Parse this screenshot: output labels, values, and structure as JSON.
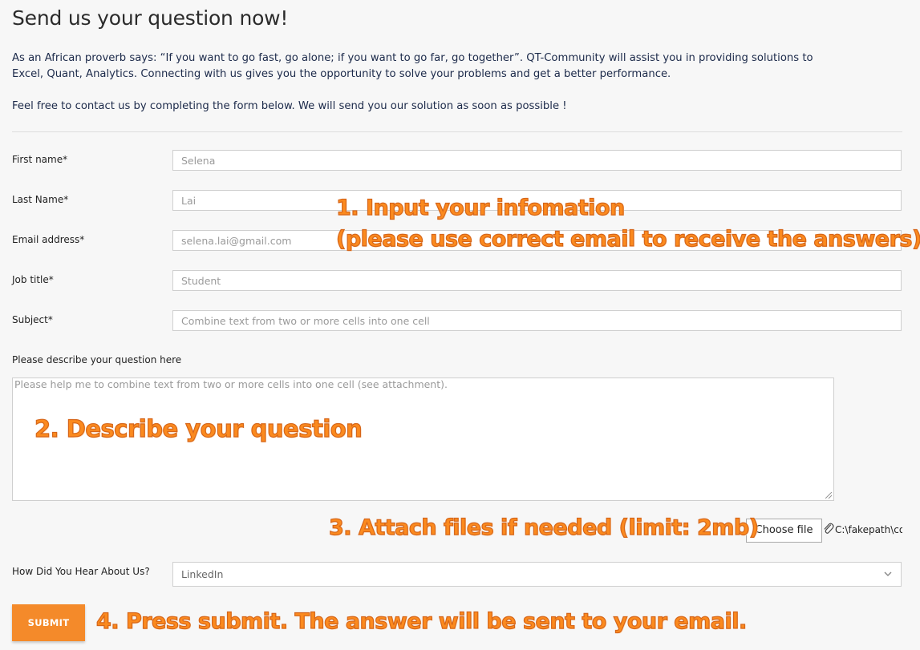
{
  "header": {
    "title": "Send us your question now!",
    "intro": "As an African proverb says: “If you want to go fast, go alone; if you want to go far, go together”. QT-Community will assist you in providing solutions to Excel, Quant, Analytics. Connecting with us gives you the opportunity to solve your problems and get a better performance.",
    "contact": "Feel free to contact us by completing the form below. We will send you our solution as soon as possible !"
  },
  "form": {
    "first_name": {
      "label": "First name*",
      "value": "Selena"
    },
    "last_name": {
      "label": "Last Name*",
      "value": "Lai"
    },
    "email": {
      "label": "Email address*",
      "value": "selena.lai@gmail.com"
    },
    "job_title": {
      "label": "Job title*",
      "value": "Student"
    },
    "subject": {
      "label": "Subject*",
      "value": "Combine text from two or more cells into one cell"
    },
    "description": {
      "label": "Please describe your question here",
      "value": "Please help me to combine text from two or more cells into one cell (see attachment)."
    },
    "file": {
      "button": "Choose file",
      "path": "C:\\fakepath\\combine-text.xlsx"
    },
    "hear_about": {
      "label": "How Did You Hear About Us?",
      "selected": "LinkedIn"
    },
    "submit_label": "SUBMIT"
  },
  "annotations": {
    "step1_line1": "1. Input your infomation",
    "step1_line2": "(please use correct email to receive the answers)",
    "step2": "2. Describe your question",
    "step3": "3. Attach files if needed (limit: 2mb)",
    "step4": "4. Press submit. The answer will be sent to your email."
  },
  "colors": {
    "accent": "#f48a2a",
    "annotation": "#fb8a1e"
  },
  "icons": {
    "attachment": "paperclip-icon",
    "dropdown": "chevron-down-icon"
  }
}
